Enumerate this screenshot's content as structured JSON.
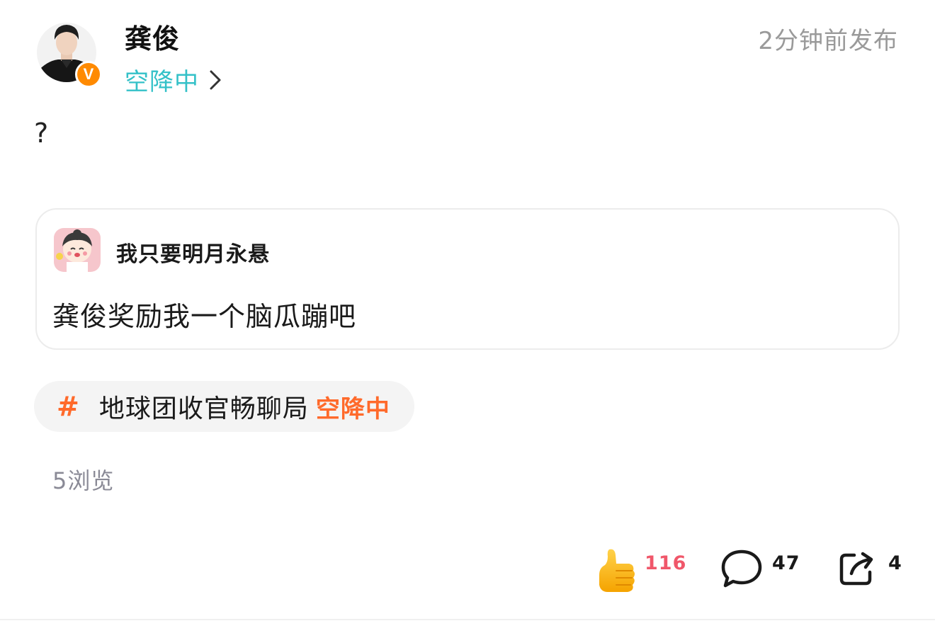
{
  "post": {
    "author": "龚俊",
    "status_label": "空降中",
    "time": "2分钟前发布",
    "text": "?",
    "verified_badge": "V"
  },
  "quote": {
    "username": "我只要明月永悬",
    "text": "龚俊奖励我一个脑瓜蹦吧"
  },
  "topic": {
    "hash": "#",
    "name": "地球团收官畅聊局",
    "tag": "空降中"
  },
  "views": "5浏览",
  "actions": {
    "like_count": "116",
    "comment_count": "47",
    "share_count": "4"
  },
  "icons": {
    "chevron": "chevron-right-icon",
    "like": "thumbs-up-icon",
    "comment": "speech-bubble-icon",
    "share": "share-arrow-icon"
  },
  "colors": {
    "status_teal": "#34c1c8",
    "topic_orange": "#ff6a2b",
    "like_red": "#f0576a",
    "badge_orange": "#ff8a00"
  }
}
